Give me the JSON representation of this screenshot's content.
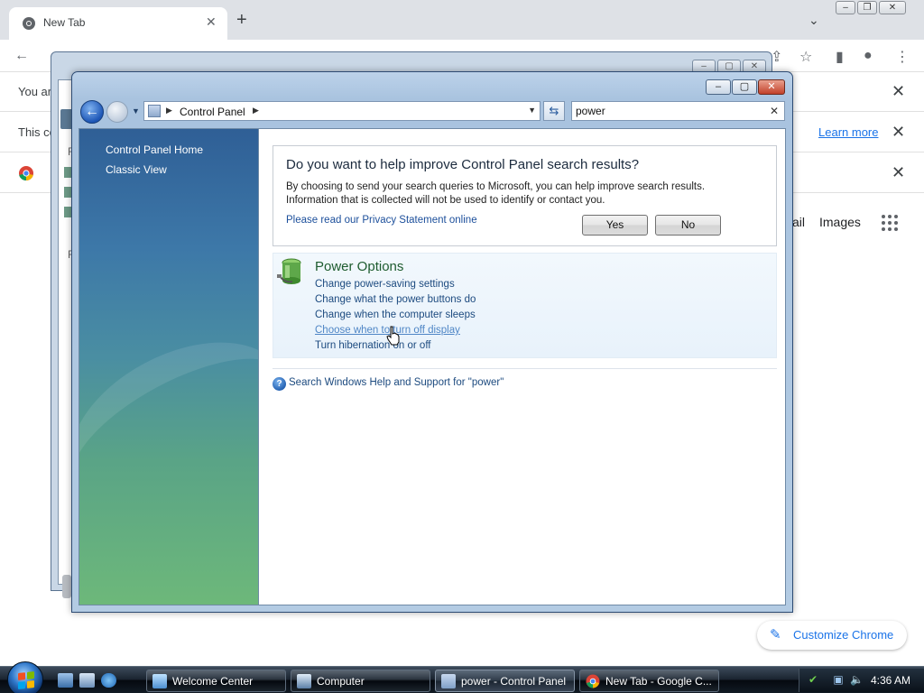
{
  "chrome": {
    "tab_title": "New Tab",
    "infobar1_text": "You ar",
    "infobar2_text": "This co",
    "learn_more": "Learn more",
    "gmail_partial": "ail",
    "images": "Images",
    "customize": "Customize Chrome"
  },
  "bg_window": {
    "fragments": [
      "R",
      "R"
    ]
  },
  "control_panel": {
    "address_crumb": "Control Panel",
    "search_value": "power",
    "sidebar": {
      "home": "Control Panel Home",
      "classic": "Classic View"
    },
    "improve": {
      "title": "Do you want to help improve Control Panel search results?",
      "line1": "By choosing to send your search queries to Microsoft, you can help improve search results.",
      "line2": "Information that is collected will not be used to identify or contact you.",
      "privacy_link": "Please read our Privacy Statement online",
      "yes": "Yes",
      "no": "No"
    },
    "result": {
      "title": "Power Options",
      "links": [
        "Change power-saving settings",
        "Change what the power buttons do",
        "Change when the computer sleeps",
        "Choose when to turn off display",
        "Turn hibernation on or off"
      ]
    },
    "help_link": "Search Windows Help and Support for \"power\""
  },
  "taskbar": {
    "buttons": [
      {
        "label": "Welcome Center"
      },
      {
        "label": "Computer"
      },
      {
        "label": "power - Control Panel"
      },
      {
        "label": "New Tab - Google C..."
      }
    ],
    "clock": "4:36 AM"
  },
  "colors": {
    "chrome_accent": "#1a73e8",
    "cp_link": "#1c4a7f",
    "result_title": "#1e5c2f"
  }
}
